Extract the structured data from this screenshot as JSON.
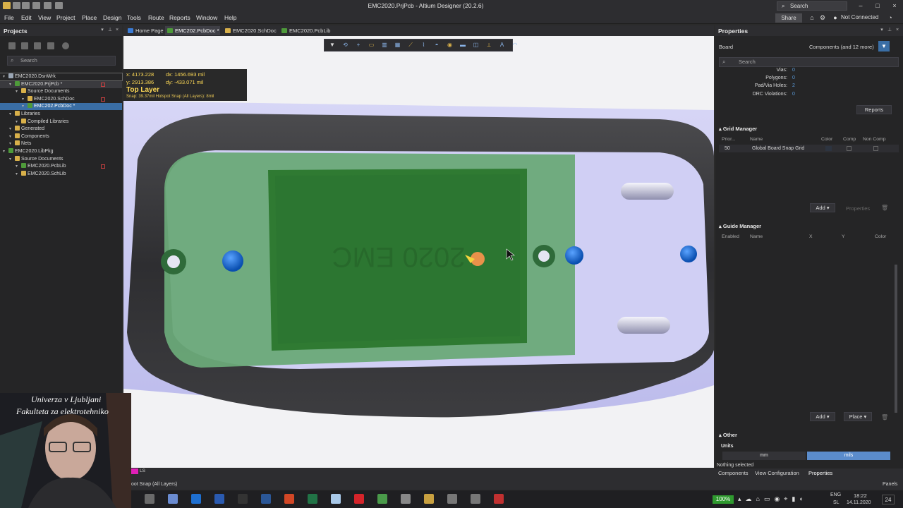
{
  "window": {
    "title": "EMC2020.PrjPcb - Altium Designer (20.2.6)",
    "search_placeholder": "Search",
    "controls": [
      "–",
      "□",
      "×"
    ]
  },
  "menu": [
    "File",
    "Edit",
    "View",
    "Project",
    "Place",
    "Design",
    "Tools",
    "Route",
    "Reports",
    "Window",
    "Help"
  ],
  "topright": {
    "share": "Share",
    "connection": "Not Connected"
  },
  "projects": {
    "title": "Projects",
    "search_placeholder": "Search",
    "tree": [
      {
        "label": "EMC2020.DsnWrk",
        "level": 0,
        "color": "#9aa6b5",
        "selected": false,
        "boxed": true,
        "mark": false
      },
      {
        "label": "EMC2020.PrjPcb *",
        "level": 1,
        "color": "#4e9a3a",
        "selected": false,
        "boxed": false,
        "mark": true,
        "bg": "#3a3a3e"
      },
      {
        "label": "Source Documents",
        "level": 2,
        "color": "#d8b04a",
        "selected": false,
        "boxed": false,
        "mark": false
      },
      {
        "label": "EMC2020.SchDoc",
        "level": 3,
        "color": "#d8b04a",
        "selected": false,
        "boxed": false,
        "mark": true
      },
      {
        "label": "EMC202.PcbDoc *",
        "level": 3,
        "color": "#4e9a3a",
        "selected": true,
        "boxed": false,
        "mark": false
      },
      {
        "label": "Libraries",
        "level": 1,
        "color": "#d8b04a",
        "selected": false,
        "boxed": false,
        "mark": false
      },
      {
        "label": "Compiled Libraries",
        "level": 2,
        "color": "#d8b04a",
        "selected": false,
        "boxed": false,
        "mark": false
      },
      {
        "label": "Generated",
        "level": 1,
        "color": "#d8b04a",
        "selected": false,
        "boxed": false,
        "mark": false
      },
      {
        "label": "Components",
        "level": 1,
        "color": "#d8b04a",
        "selected": false,
        "boxed": false,
        "mark": false
      },
      {
        "label": "Nets",
        "level": 1,
        "color": "#d8b04a",
        "selected": false,
        "boxed": false,
        "mark": false
      },
      {
        "label": "EMC2020.LibPkg",
        "level": 0,
        "color": "#4e9a3a",
        "selected": false,
        "boxed": false,
        "mark": false
      },
      {
        "label": "Source Documents",
        "level": 1,
        "color": "#d8b04a",
        "selected": false,
        "boxed": false,
        "mark": false
      },
      {
        "label": "EMC2020.PcbLib",
        "level": 2,
        "color": "#4e9a3a",
        "selected": false,
        "boxed": false,
        "mark": true
      },
      {
        "label": "EMC2020.SchLib",
        "level": 2,
        "color": "#d8b04a",
        "selected": false,
        "boxed": false,
        "mark": false
      }
    ]
  },
  "tabs": [
    {
      "label": "Home Page",
      "color": "#3a7bd5",
      "active": false
    },
    {
      "label": "EMC202.PcbDoc *",
      "color": "#4e9a3a",
      "active": true
    },
    {
      "label": "EMC2020.SchDoc",
      "color": "#d8b04a",
      "active": false
    },
    {
      "label": "EMC2020.PcbLib",
      "color": "#4e9a3a",
      "active": false
    }
  ],
  "hud": {
    "x": "x: 4173.228",
    "dx": "dx: 1456.693 mil",
    "y": "y: 2913.386",
    "dy": "dy: -433.071 mil",
    "layer": "Top Layer",
    "snap": "Snap: 39.37mil Hotspot Snap (All Layers): 8mil"
  },
  "board_text": "2020 EMC",
  "properties": {
    "title": "Properties",
    "board_label": "Board",
    "components_filter": "Components (and 12 more)",
    "search_placeholder": "Search",
    "stats": [
      {
        "label": "Vias:",
        "value": "0"
      },
      {
        "label": "Polygons:",
        "value": "0"
      },
      {
        "label": "Pad/Via Holes:",
        "value": "2"
      },
      {
        "label": "DRC Violations:",
        "value": "0"
      }
    ],
    "reports_btn": "Reports",
    "grid_manager": {
      "title": "Grid Manager",
      "columns": [
        "Prior...",
        "Name",
        "Color",
        "Comp",
        "Non Comp"
      ],
      "rows": [
        {
          "priority": "50",
          "name": "Global Board Snap Grid",
          "color": "#2d3440"
        }
      ],
      "add_btn": "Add ▾",
      "properties_btn": "Properties"
    },
    "guide_manager": {
      "title": "Guide Manager",
      "columns": [
        "Enabled",
        "Name",
        "X",
        "Y",
        "Color"
      ],
      "add_btn": "Add ▾",
      "place_btn": "Place ▾"
    },
    "other": {
      "title": "Other",
      "units_label": "Units",
      "units": [
        "mm",
        "mils"
      ],
      "active_unit": "mils"
    },
    "status": "Nothing selected"
  },
  "bottom_tabs": [
    "Components",
    "View Configuration",
    "Properties"
  ],
  "status": {
    "layer_label": "LS",
    "snap_text": "oot Snap (All Layers)",
    "panels_btn": "Panels"
  },
  "taskbar": {
    "battery": "100%",
    "lang": "ENG",
    "region": "SL",
    "time": "18:22",
    "date": "14.11.2020",
    "notif": "24"
  },
  "webcam": {
    "line1": "Univerza v Ljubljani",
    "line2": "Fakulteta za elektrotehniko"
  }
}
